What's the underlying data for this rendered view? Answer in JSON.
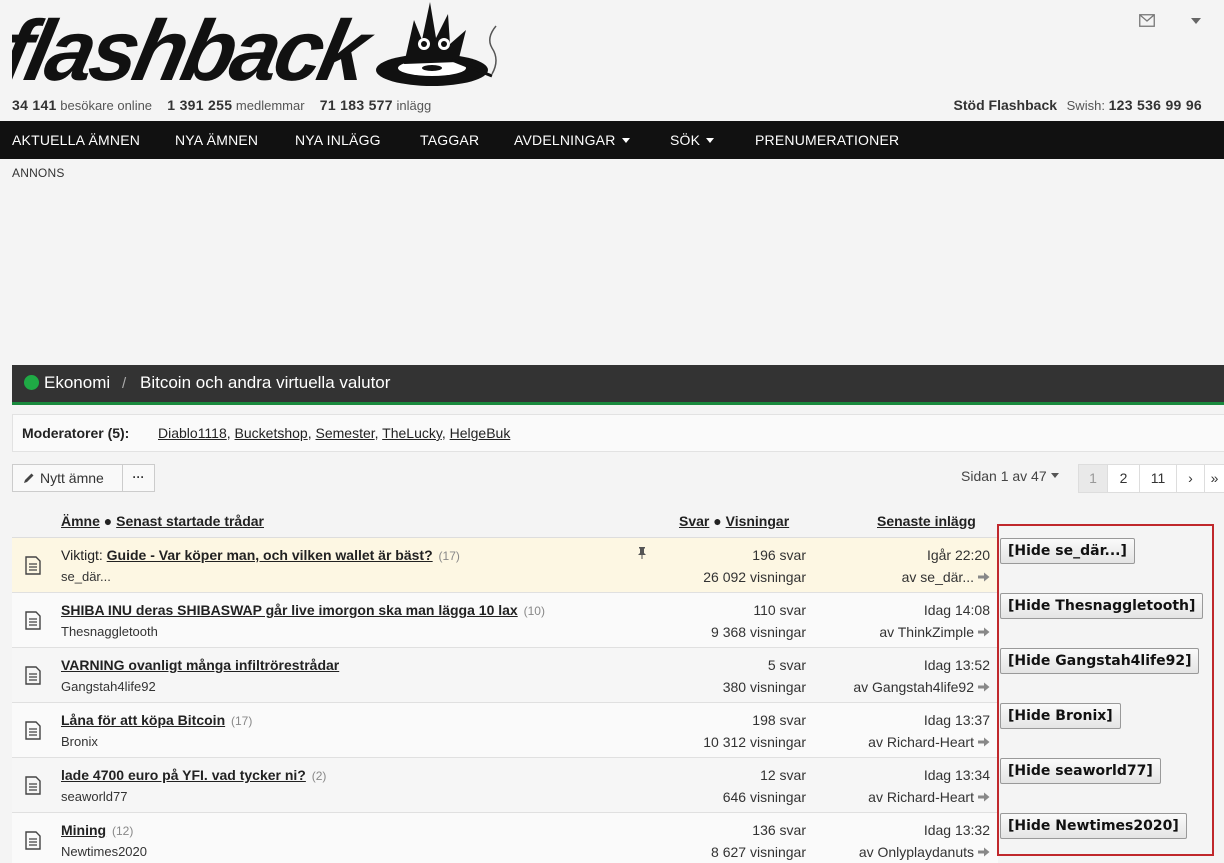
{
  "header": {
    "logo_text": "flashback",
    "stats": {
      "visitors": "34 141",
      "visitors_label": "besökare online",
      "members": "1 391 255",
      "members_label": "medlemmar",
      "posts": "71 183 577",
      "posts_label": "inlägg"
    },
    "support": {
      "title": "Stöd Flashback",
      "swish_label": "Swish:",
      "swish_number": "123 536 99 96"
    }
  },
  "nav": {
    "items": [
      {
        "label": "AKTUELLA ÄMNEN"
      },
      {
        "label": "NYA ÄMNEN"
      },
      {
        "label": "NYA INLÄGG"
      },
      {
        "label": "TAGGAR"
      },
      {
        "label": "AVDELNINGAR"
      },
      {
        "label": "SÖK"
      },
      {
        "label": "PRENUMERATIONER"
      }
    ]
  },
  "annons": "ANNONS",
  "forum": {
    "breadcrumb": [
      "Ekonomi",
      "/",
      "Bitcoin och andra virtuella valutor"
    ],
    "moderators_label": "Moderatorer (5):",
    "moderators": [
      "Diablo1118",
      "Bucketshop",
      "Semester",
      "TheLucky",
      "HelgeBuk"
    ]
  },
  "toolbar": {
    "new_topic": "Nytt ämne",
    "more": "···",
    "page_info": "Sidan 1 av 47",
    "pages": [
      "1",
      "2",
      "11",
      "›",
      "»"
    ]
  },
  "table": {
    "headers": {
      "topic": "Ämne",
      "bullet": "●",
      "latest_started": "Senast startade trådar",
      "replies": "Svar",
      "views": "Visningar",
      "last_post": "Senaste inlägg"
    },
    "rows": [
      {
        "prefix": "Viktigt:",
        "title": "Guide - Var köper man, och vilken wallet är bäst?",
        "pages": "(17)",
        "author": "se_där...",
        "replies": "196 svar",
        "views": "26 092 visningar",
        "time": "Igår 22:20",
        "by": "av se_där..."
      },
      {
        "prefix": "",
        "title": "SHIBA INU deras SHIBASWAP går live imorgon ska man lägga 10 lax",
        "pages": "(10)",
        "author": "Thesnaggletooth",
        "replies": "110 svar",
        "views": "9 368 visningar",
        "time": "Idag 14:08",
        "by": "av ThinkZimple"
      },
      {
        "prefix": "",
        "title": "VARNING ovanligt många infiltrörestrådar",
        "pages": "",
        "author": "Gangstah4life92",
        "replies": "5 svar",
        "views": "380 visningar",
        "time": "Idag 13:52",
        "by": "av Gangstah4life92"
      },
      {
        "prefix": "",
        "title": "Låna för att köpa Bitcoin",
        "pages": "(17)",
        "author": "Bronix",
        "replies": "198 svar",
        "views": "10 312 visningar",
        "time": "Idag 13:37",
        "by": "av Richard-Heart"
      },
      {
        "prefix": "",
        "title": "lade 4700 euro på YFI. vad tycker ni?",
        "pages": "(2)",
        "author": "seaworld77",
        "replies": "12 svar",
        "views": "646 visningar",
        "time": "Idag 13:34",
        "by": "av Richard-Heart"
      },
      {
        "prefix": "",
        "title": "Mining",
        "pages": "(12)",
        "author": "Newtimes2020",
        "replies": "136 svar",
        "views": "8 627 visningar",
        "time": "Idag 13:32",
        "by": "av Onlyplaydanuts"
      }
    ]
  },
  "hide_buttons": [
    "[Hide se_där...]",
    "[Hide Thesnaggletooth]",
    "[Hide Gangstah4life92]",
    "[Hide Bronix]",
    "[Hide seaworld77]",
    "[Hide Newtimes2020]"
  ],
  "colors": {
    "nav_bg": "#111111",
    "forum_bar": "#333333",
    "accent_green": "#1faa45",
    "sticky_row": "#fdf7e3",
    "hide_border": "#c0282c"
  }
}
